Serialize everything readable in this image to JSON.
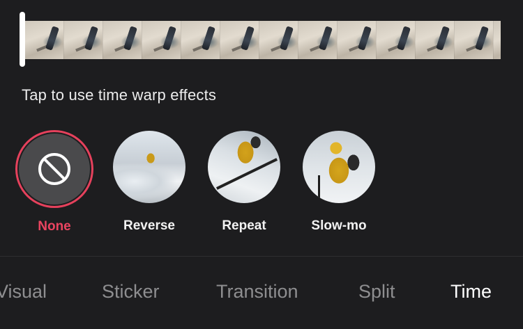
{
  "timeline": {
    "frame_count": 12
  },
  "hint": "Tap to use time warp effects",
  "effects": [
    {
      "label": "None",
      "selected": true,
      "icon": "none-icon"
    },
    {
      "label": "Reverse",
      "selected": false
    },
    {
      "label": "Repeat",
      "selected": false
    },
    {
      "label": "Slow-mo",
      "selected": false
    }
  ],
  "tabs": [
    {
      "label": "Visual",
      "active": false
    },
    {
      "label": "Sticker",
      "active": false
    },
    {
      "label": "Transition",
      "active": false
    },
    {
      "label": "Split",
      "active": false
    },
    {
      "label": "Time",
      "active": true
    }
  ],
  "colors": {
    "background": "#1d1d1f",
    "accent": "#ea4460",
    "tab_inactive": "#8e8e90",
    "tab_active": "#ffffff"
  }
}
